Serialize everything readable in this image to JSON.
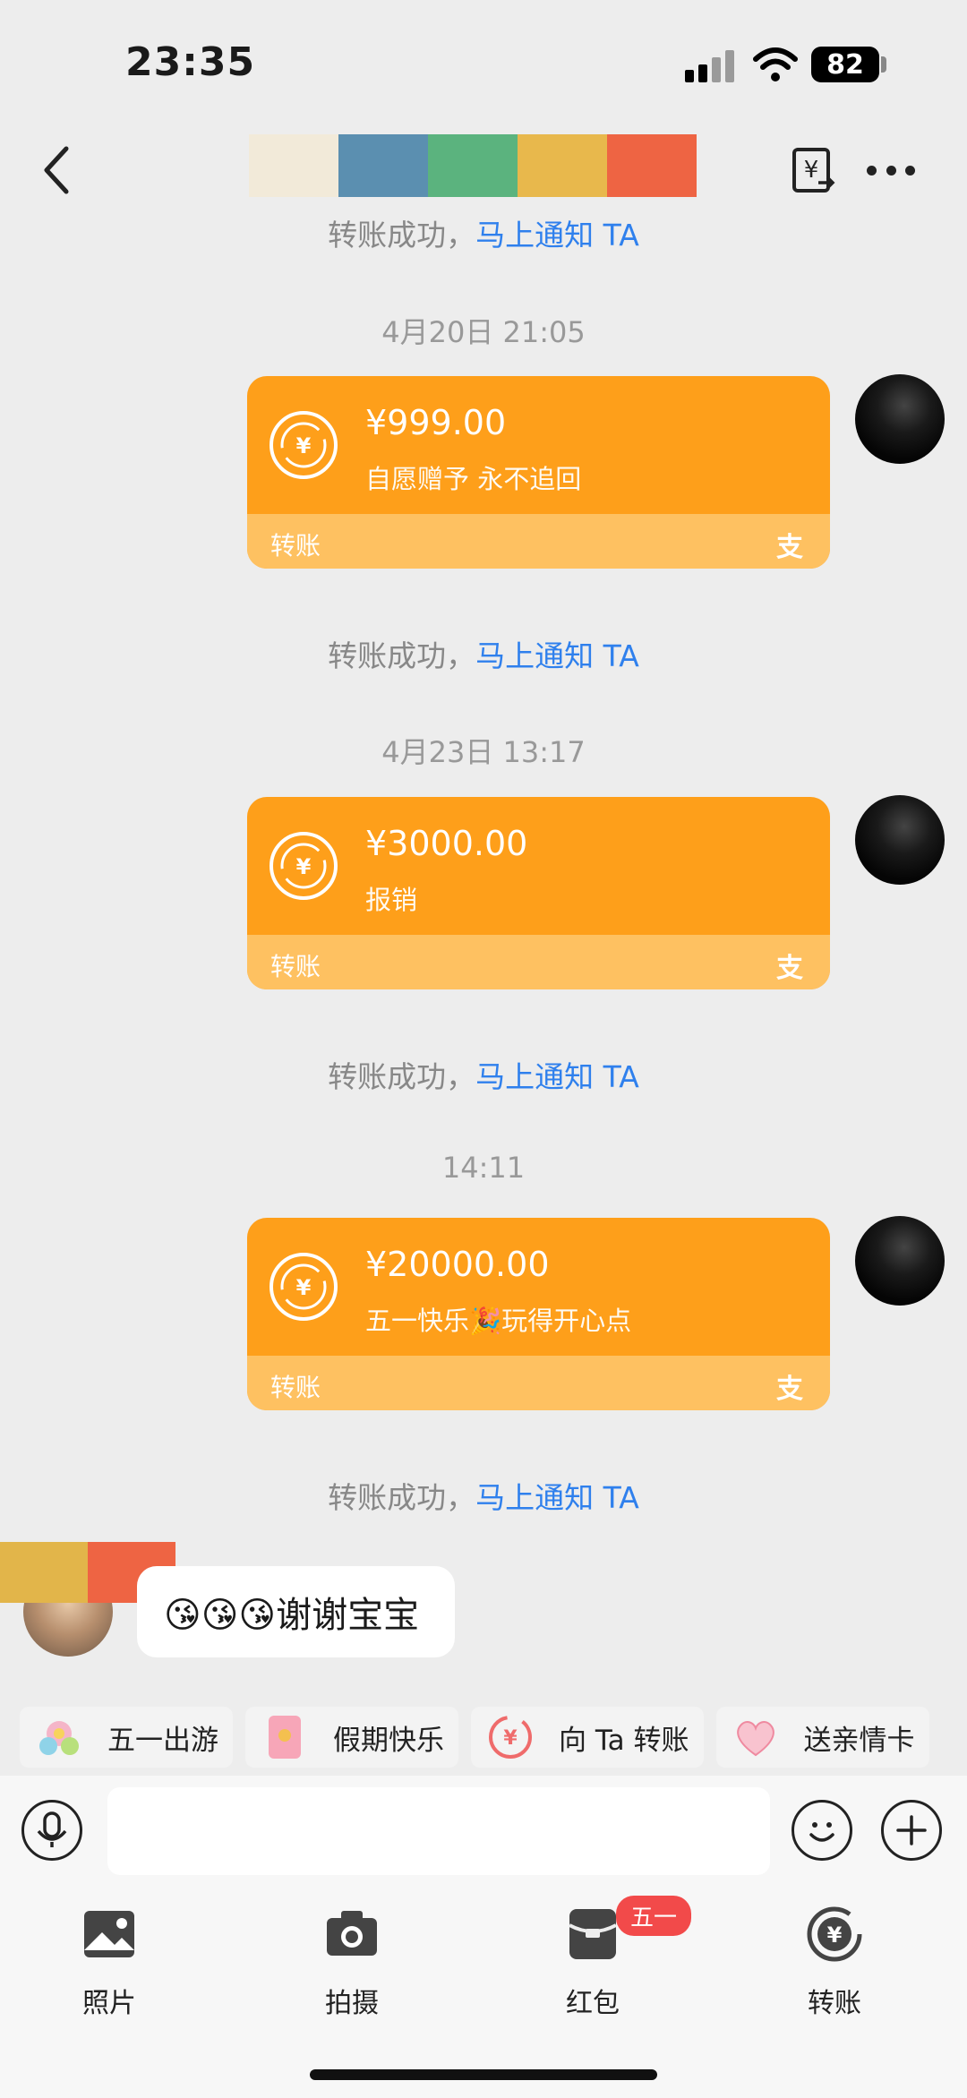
{
  "status_bar": {
    "time": "23:35",
    "battery": "82"
  },
  "header": {
    "name_mosaic_colors": [
      "#f2ead9",
      "#5b8fb0",
      "#5bb37e",
      "#e8b84c",
      "#ee6443"
    ]
  },
  "messages": [
    {
      "type": "system",
      "text": "转账成功，",
      "link": "马上通知 TA"
    },
    {
      "type": "timestamp",
      "text": "4月20日 21:05"
    },
    {
      "type": "transfer",
      "amount": "¥999.00",
      "note": "自愿赠予 永不追回",
      "label": "转账",
      "brand": "支"
    },
    {
      "type": "system",
      "text": "转账成功，",
      "link": "马上通知 TA"
    },
    {
      "type": "timestamp",
      "text": "4月23日 13:17"
    },
    {
      "type": "transfer",
      "amount": "¥3000.00",
      "note": "报销",
      "label": "转账",
      "brand": "支"
    },
    {
      "type": "system",
      "text": "转账成功，",
      "link": "马上通知 TA"
    },
    {
      "type": "timestamp",
      "text": "14:11"
    },
    {
      "type": "transfer",
      "amount": "¥20000.00",
      "note": "五一快乐🎉玩得开心点",
      "label": "转账",
      "brand": "支"
    },
    {
      "type": "system",
      "text": "转账成功，",
      "link": "马上通知 TA"
    },
    {
      "type": "incoming",
      "text": "😘😘😘谢谢宝宝"
    }
  ],
  "quick_actions": [
    {
      "label": "五一出游",
      "icon": "travel-icon"
    },
    {
      "label": "假期快乐",
      "icon": "red-envelope-icon"
    },
    {
      "label": "向 Ta 转账",
      "icon": "yuan-transfer-icon"
    },
    {
      "label": "送亲情卡",
      "icon": "heart-card-icon"
    }
  ],
  "bottom_bar": [
    {
      "label": "照片",
      "icon": "photo-icon"
    },
    {
      "label": "拍摄",
      "icon": "camera-icon"
    },
    {
      "label": "红包",
      "icon": "red-packet-icon",
      "badge": "五一"
    },
    {
      "label": "转账",
      "icon": "transfer-icon"
    }
  ],
  "colors": {
    "card": "#fe9f1a",
    "card_footer": "#fec161",
    "link": "#2f80ed",
    "badge": "#f24a4a"
  }
}
